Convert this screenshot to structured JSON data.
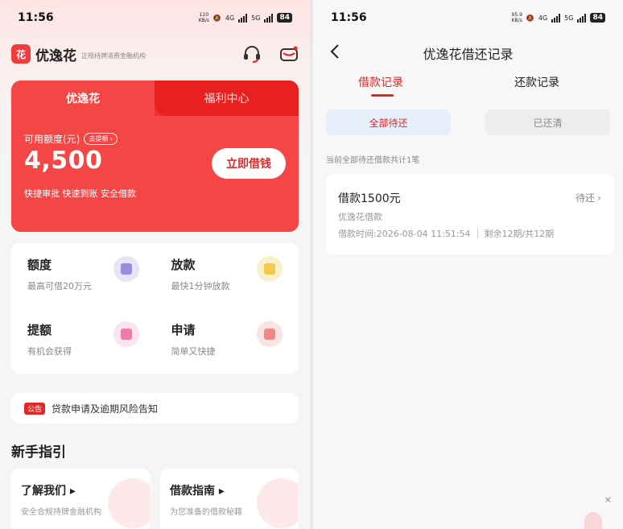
{
  "status_bar_left": {
    "time": "11:56",
    "speed_top": "110",
    "speed_bottom": "KB/s",
    "net1": "4G",
    "net2": "5G",
    "battery": "84"
  },
  "status_bar_right": {
    "time": "11:56",
    "speed_top": "95.9",
    "speed_bottom": "KB/s",
    "net1": "4G",
    "net2": "5G",
    "battery": "84"
  },
  "header": {
    "logo_text": "花",
    "app_name": "优逸花",
    "subtitle": "正规持牌消费金融机构",
    "icons": [
      "headset-icon",
      "mail-icon"
    ]
  },
  "card": {
    "tab_active": "优逸花",
    "tab_inactive": "福利中心",
    "credit_label": "可用额度(元)",
    "raise_label": "去提额",
    "amount": "4,500",
    "features": "快捷审批  快速到账  安全借款",
    "borrow_button": "立即借钱"
  },
  "grid": [
    {
      "title": "额度",
      "desc": "最高可借20万元",
      "icon": "wallet-icon",
      "color": "#e7e4f8",
      "inner": "#9b8ce0"
    },
    {
      "title": "放款",
      "desc": "最快1分钟放款",
      "icon": "cash-icon",
      "color": "#fbf0cc",
      "inner": "#f2c94c"
    },
    {
      "title": "提额",
      "desc": "有机会获得",
      "icon": "star-icon",
      "color": "#fbe4ef",
      "inner": "#f07aa8"
    },
    {
      "title": "申请",
      "desc": "简单又快捷",
      "icon": "document-icon",
      "color": "#fbe3e3",
      "inner": "#ef8a8a"
    }
  ],
  "notice": {
    "badge": "公告",
    "text": "贷款申请及逾期风险告知"
  },
  "guide": {
    "title": "新手指引",
    "cards": [
      {
        "title": "了解我们 ▸",
        "desc": "安全合规持牌金融机构"
      },
      {
        "title": "借款指南 ▸",
        "desc": "为您准备的借款秘籍"
      }
    ]
  },
  "records": {
    "title": "优逸花借还记录",
    "tabs": {
      "borrow": "借款记录",
      "repay": "还款记录"
    },
    "filters": {
      "pending": "全部待还",
      "cleared": "已还清"
    },
    "count_text": "当前全部待还借款共计1笔",
    "loan": {
      "amount": "借款1500元",
      "status": "待还",
      "product": "优逸花借款",
      "time": "借款时间:2026-08-04 11:51:54",
      "periods": "剩余12期/共12期"
    },
    "close": "×"
  },
  "colors": {
    "brand_red": "#f23232",
    "accent_red": "#e52626"
  }
}
